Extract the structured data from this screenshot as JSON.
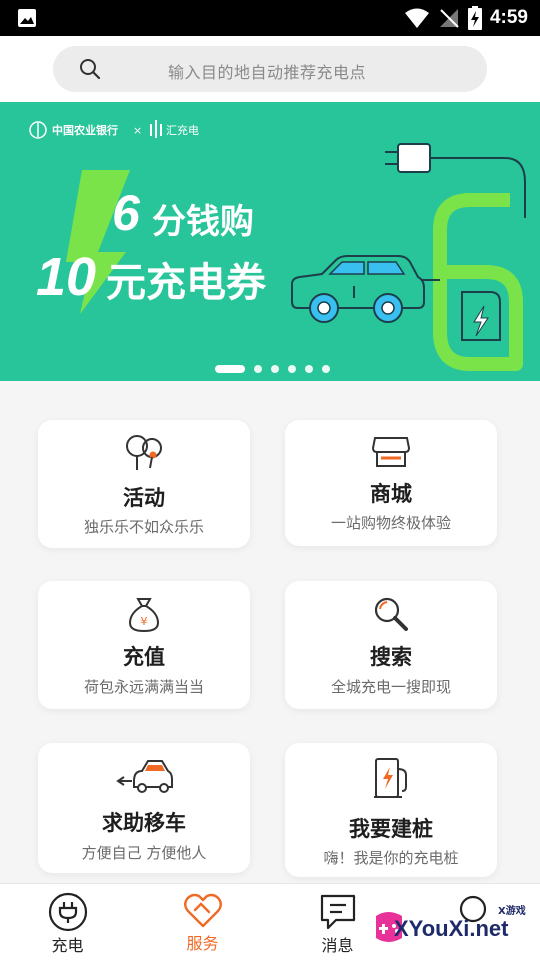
{
  "status_bar": {
    "time": "4:59"
  },
  "search": {
    "placeholder": "输入目的地自动推荐充电点"
  },
  "banner": {
    "brand_left": "中国农业银行",
    "brand_right": "汇充电",
    "number_top": "6",
    "line1": "分钱购",
    "number_bottom": "10",
    "line2": "元充电券",
    "slide_count": 6,
    "active_slide": 1
  },
  "services": [
    {
      "title": "活动",
      "subtitle": "独乐乐不如众乐乐",
      "icon": "balloon-icon"
    },
    {
      "title": "商城",
      "subtitle": "一站购物终极体验",
      "icon": "shop-icon"
    },
    {
      "title": "充值",
      "subtitle": "荷包永远满满当当",
      "icon": "money-bag-icon"
    },
    {
      "title": "搜索",
      "subtitle": "全城充电一搜即现",
      "icon": "search-icon"
    },
    {
      "title": "求助移车",
      "subtitle": "方便自己 方便他人",
      "icon": "move-car-icon"
    },
    {
      "title": "我要建桩",
      "subtitle": "嗨！我是你的充电桩",
      "icon": "charging-pile-icon"
    }
  ],
  "bottom_nav": [
    {
      "label": "充电",
      "icon": "plug-icon",
      "active": false
    },
    {
      "label": "服务",
      "icon": "heart-icon",
      "active": true
    },
    {
      "label": "消息",
      "icon": "message-icon",
      "active": false
    },
    {
      "label": "",
      "icon": "discover-icon",
      "active": false
    }
  ],
  "watermark": {
    "text": "XYouXi.net",
    "small": "X游戏"
  },
  "colors": {
    "accent": "#f06a25",
    "banner_bg": "#29c59a",
    "banner_green": "#7be34a",
    "car_blue": "#3ac0f0"
  }
}
